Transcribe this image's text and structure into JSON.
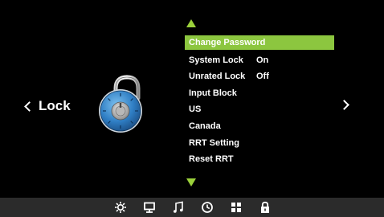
{
  "page": {
    "title": "Lock"
  },
  "menu": {
    "items": [
      {
        "label": "Change Password",
        "value": "",
        "selected": true
      },
      {
        "label": "System Lock",
        "value": "On",
        "selected": false
      },
      {
        "label": "Unrated Lock",
        "value": "Off",
        "selected": false
      },
      {
        "label": "Input Block",
        "value": "",
        "selected": false
      },
      {
        "label": "US",
        "value": "",
        "selected": false
      },
      {
        "label": "Canada",
        "value": "",
        "selected": false
      },
      {
        "label": "RRT Setting",
        "value": "",
        "selected": false
      },
      {
        "label": "Reset RRT",
        "value": "",
        "selected": false
      }
    ]
  },
  "bottom_nav": {
    "icons": [
      "settings-icon",
      "monitor-icon",
      "music-icon",
      "clock-icon",
      "grid-icon",
      "lock-icon"
    ],
    "active": "lock-icon"
  },
  "colors": {
    "accent": "#8cc63f",
    "background": "#000000",
    "bar": "#2b2b2b",
    "padlock_blue": "#3a86c8"
  }
}
